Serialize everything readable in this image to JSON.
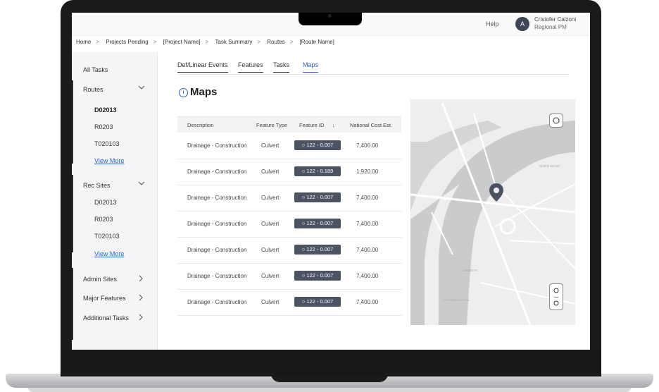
{
  "header": {
    "help_label": "Help",
    "user": {
      "initial": "A",
      "name": "Cristofer Calzoni",
      "role": "Regional PM"
    }
  },
  "breadcrumb": [
    "Home",
    "Projects Pending",
    "[Project Name]",
    "Task Summary",
    "Routes",
    "[Route Name]"
  ],
  "breadcrumb_separator": ">",
  "sidebar": {
    "all_tasks": "All Tasks",
    "routes": {
      "label": "Routes",
      "items": [
        "D02013",
        "R0203",
        "T020103"
      ],
      "view_more": "View More"
    },
    "rec_sites": {
      "label": "Rec Sites",
      "items": [
        "D02013",
        "R0203",
        "T020103"
      ],
      "view_more": "View More"
    },
    "groups": [
      "Admin Sites",
      "Major Features",
      "Additional Tasks"
    ]
  },
  "tabs": [
    "Def/Linear Events",
    "Features",
    "Tasks",
    "Maps"
  ],
  "active_tab": "Maps",
  "page_title": "Maps",
  "table": {
    "columns": [
      "Description",
      "Feature Type",
      "Feature ID",
      "National Cost Est."
    ],
    "sort_indicator": "↓",
    "rows": [
      {
        "description": "Drainage - Construction",
        "type": "Culvert",
        "id": "122 - 0.007",
        "cost": "7,400.00"
      },
      {
        "description": "Drainage - Construction",
        "type": "Culvert",
        "id": "122 - 0.189",
        "cost": "1,920.00"
      },
      {
        "description": "Drainage - Construction",
        "type": "Culvert",
        "id": "122 - 0.007",
        "cost": "7,400.00"
      },
      {
        "description": "Drainage - Construction",
        "type": "Culvert",
        "id": "122 - 0.007",
        "cost": "7,400.00"
      },
      {
        "description": "Drainage - Construction",
        "type": "Culvert",
        "id": "122 - 0.007",
        "cost": "7,400.00"
      },
      {
        "description": "Drainage - Construction",
        "type": "Culvert",
        "id": "122 - 0.007",
        "cost": "7,400.00"
      },
      {
        "description": "Drainage - Construction",
        "type": "Culvert",
        "id": "122 - 0.007",
        "cost": "7,400.00"
      }
    ]
  },
  "map": {
    "labels": [
      "NORTH BANK",
      "LAMBETH",
      "ST THOMAS HOSPITAL"
    ],
    "colors": {
      "water": "#c9cbcc",
      "land": "#eeeeee",
      "roads": "#ffffff",
      "pin": "#4a5462"
    }
  },
  "icons": [
    "info-icon",
    "chevron-down-icon",
    "chevron-right-icon",
    "map-pin-icon",
    "zoom-in-icon",
    "zoom-out-icon",
    "locate-icon",
    "sort-down-icon"
  ]
}
